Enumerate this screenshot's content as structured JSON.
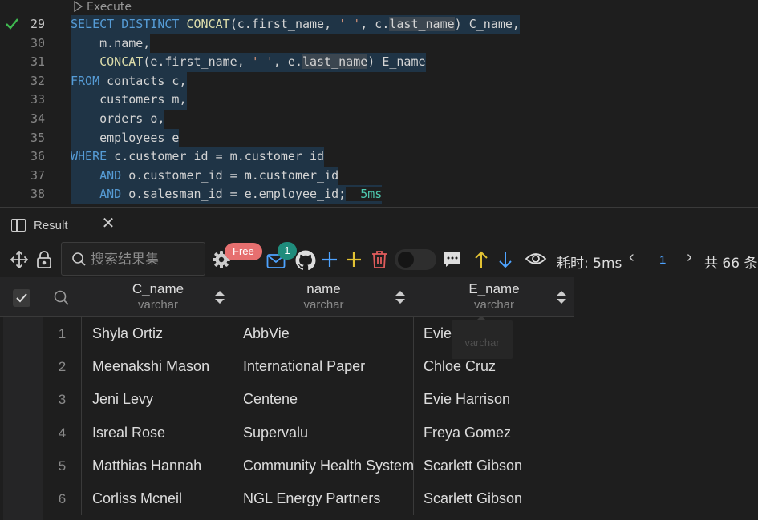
{
  "editor": {
    "codelens": "Execute",
    "lines": [
      {
        "n": "29",
        "active": true,
        "segments": [
          {
            "t": "SELECT DISTINCT ",
            "c": "kw"
          },
          {
            "t": "CONCAT",
            "c": "fn"
          },
          {
            "t": "(c.first_name, "
          },
          {
            "t": "' '",
            "c": "str"
          },
          {
            "t": ", c."
          },
          {
            "t": "last_name",
            "c": "hl"
          },
          {
            "t": ") C_name,"
          }
        ]
      },
      {
        "n": "30",
        "segments": [
          {
            "t": "    m.name,"
          }
        ]
      },
      {
        "n": "31",
        "segments": [
          {
            "t": "    "
          },
          {
            "t": "CONCAT",
            "c": "fn"
          },
          {
            "t": "(e.first_name, "
          },
          {
            "t": "' '",
            "c": "str"
          },
          {
            "t": ", e."
          },
          {
            "t": "last_name",
            "c": "hl"
          },
          {
            "t": ") E_name"
          }
        ]
      },
      {
        "n": "32",
        "segments": [
          {
            "t": "FROM ",
            "c": "kw"
          },
          {
            "t": "contacts c,"
          }
        ]
      },
      {
        "n": "33",
        "segments": [
          {
            "t": "    customers m,"
          }
        ]
      },
      {
        "n": "34",
        "segments": [
          {
            "t": "    orders o,"
          }
        ]
      },
      {
        "n": "35",
        "segments": [
          {
            "t": "    employees e"
          }
        ]
      },
      {
        "n": "36",
        "segments": [
          {
            "t": "WHERE ",
            "c": "kw"
          },
          {
            "t": "c.customer_id = m.customer_id"
          }
        ]
      },
      {
        "n": "37",
        "segments": [
          {
            "t": "    "
          },
          {
            "t": "AND ",
            "c": "kw"
          },
          {
            "t": "o.customer_id = m.customer_id"
          }
        ]
      },
      {
        "n": "38",
        "segments": [
          {
            "t": "    "
          },
          {
            "t": "AND ",
            "c": "kw"
          },
          {
            "t": "o.salesman_id = e.employee_id;"
          },
          {
            "t": "  5ms",
            "c": "time"
          }
        ]
      }
    ]
  },
  "result_panel": {
    "tab_label": "Result",
    "close_glyph": "✕"
  },
  "toolbar": {
    "search_placeholder": "搜索结果集",
    "free_badge": "Free",
    "mail_badge": "1",
    "elapsed": "耗时: 5ms",
    "page": "1",
    "total": "共 66 条",
    "prev_glyph": "‹",
    "next_glyph": "›",
    "icons": [
      "move-icon",
      "lock-icon",
      "gear-icon",
      "mail-icon",
      "github-icon",
      "add-row-icon",
      "add-icon",
      "delete-icon",
      "toggle",
      "comment-icon",
      "arrow-up-icon",
      "arrow-down-icon",
      "eye-icon"
    ],
    "colors": {
      "blue": "#4ea3ff",
      "yellow": "#e2c233",
      "red": "#e25c5c",
      "accent_green": "#1f8c7c"
    }
  },
  "grid": {
    "columns": [
      {
        "name": "C_name",
        "type": "varchar"
      },
      {
        "name": "name",
        "type": "varchar"
      },
      {
        "name": "E_name",
        "type": "varchar"
      }
    ],
    "rows": [
      {
        "idx": "1",
        "cells": [
          "Shyla Ortiz",
          "AbbVie",
          "Evie Harrison"
        ]
      },
      {
        "idx": "2",
        "cells": [
          "Meenakshi Mason",
          "International Paper",
          "Chloe Cruz"
        ]
      },
      {
        "idx": "3",
        "cells": [
          "Jeni Levy",
          "Centene",
          "Evie Harrison"
        ]
      },
      {
        "idx": "4",
        "cells": [
          "Isreal Rose",
          "Supervalu",
          "Freya Gomez"
        ]
      },
      {
        "idx": "5",
        "cells": [
          "Matthias Hannah",
          "Community Health Systems",
          "Scarlett Gibson"
        ]
      },
      {
        "idx": "6",
        "cells": [
          "Corliss Mcneil",
          "NGL Energy Partners",
          "Scarlett Gibson"
        ]
      }
    ],
    "tooltip": "varchar"
  }
}
